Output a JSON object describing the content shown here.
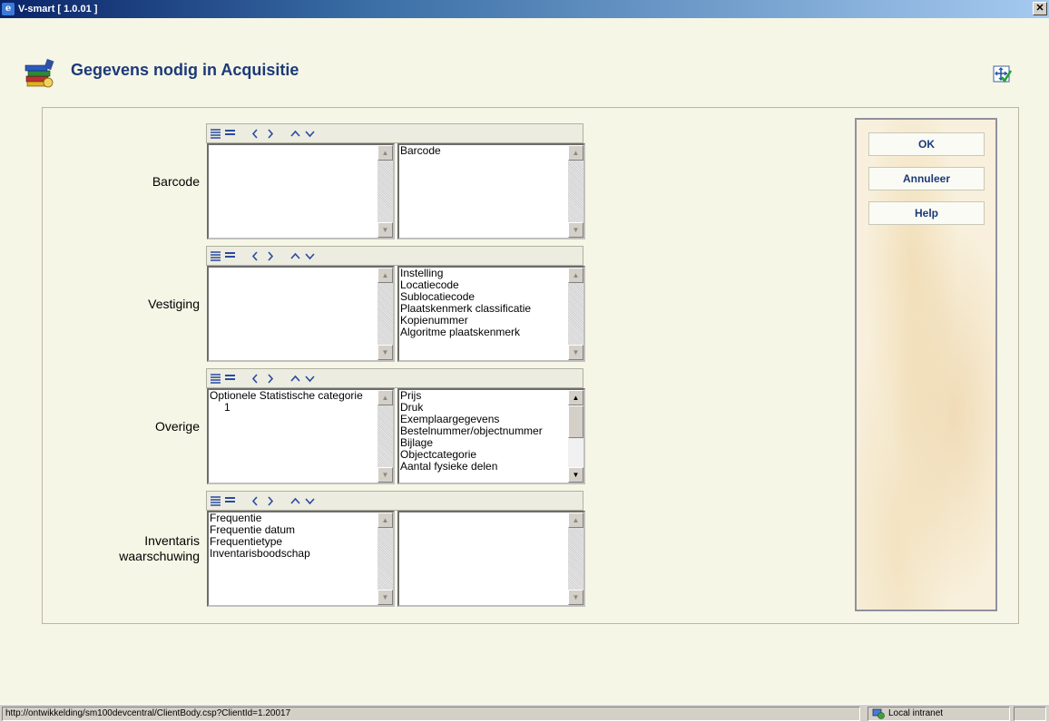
{
  "window": {
    "title": "V-smart [ 1.0.01 ]",
    "close_label": "✕"
  },
  "header": {
    "title": "Gegevens nodig in Acquisitie"
  },
  "groups": [
    {
      "label": "Barcode",
      "left_items": [],
      "right_items": [
        "Barcode"
      ]
    },
    {
      "label": "Vestiging",
      "left_items": [],
      "right_items": [
        "Instelling",
        "Locatiecode",
        "Sublocatiecode",
        "Plaatskenmerk classificatie",
        "Kopienummer",
        "Algoritme plaatskenmerk"
      ]
    },
    {
      "label": "Overige",
      "left_items": [
        "Optionele Statistische categorie",
        "1"
      ],
      "right_items": [
        "Prijs",
        "Druk",
        "Exemplaargegevens",
        "Bestelnummer/objectnummer",
        "Bijlage",
        "Objectcategorie",
        "Aantal fysieke delen"
      ]
    },
    {
      "label_line1": "Inventaris",
      "label_line2": "waarschuwing",
      "left_items": [
        "Frequentie",
        "Frequentie datum",
        "Frequentietype",
        "Inventarisboodschap"
      ],
      "right_items": []
    }
  ],
  "buttons": {
    "ok": "OK",
    "cancel": "Annuleer",
    "help": "Help"
  },
  "status": {
    "url": "http://ontwikkelding/sm100devcentral/ClientBody.csp?ClientId=1.20017",
    "zone": "Local intranet"
  },
  "colors": {
    "accent": "#1c3a78",
    "background": "#f6f6e6"
  }
}
